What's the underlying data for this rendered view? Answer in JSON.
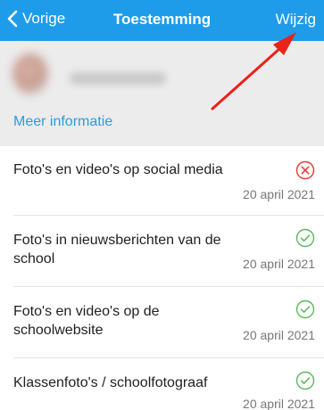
{
  "nav": {
    "back_label": "Vorige",
    "title": "Toestemming",
    "edit_label": "Wijzig",
    "bar_color": "#1E9CEA"
  },
  "profile": {
    "more_info_label": "Meer informatie"
  },
  "consents": [
    {
      "label": "Foto's en video's op social media",
      "date": "20 april 2021",
      "status": "denied",
      "icon": "x-circle-icon"
    },
    {
      "label": "Foto's in nieuwsberichten van de school",
      "date": "20 april 2021",
      "status": "granted",
      "icon": "check-circle-icon"
    },
    {
      "label": "Foto's en video's op de schoolwebsite",
      "date": "20 april 2021",
      "status": "granted",
      "icon": "check-circle-icon"
    },
    {
      "label": "Klassenfoto's / schoolfotograaf",
      "date": "20 april 2021",
      "status": "granted",
      "icon": "check-circle-icon"
    }
  ],
  "colors": {
    "denied": "#E53935",
    "granted": "#5CB85C",
    "link": "#2A9CDD",
    "annotation_arrow": "#E8231A"
  }
}
